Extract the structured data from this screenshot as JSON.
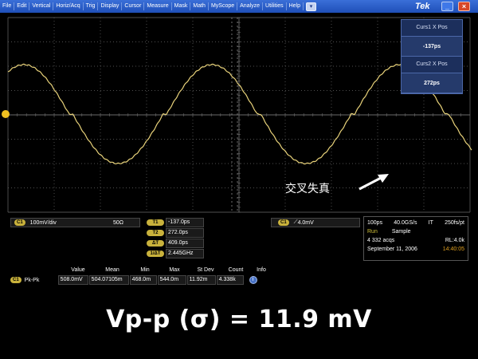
{
  "menubar": {
    "items": [
      "File",
      "Edit",
      "Vertical",
      "Horiz/Acq",
      "Trig",
      "Display",
      "Cursor",
      "Measure",
      "Mask",
      "Math",
      "MyScope",
      "Analyze",
      "Utilities",
      "Help"
    ],
    "brand": "Tek",
    "dropdown_symbol": "▾",
    "minimize_symbol": "_",
    "close_symbol": "×"
  },
  "cursor_box": {
    "curs1_label": "Curs1 X Pos",
    "curs1_value": "-137ps",
    "curs2_label": "Curs2 X Pos",
    "curs2_value": "272ps"
  },
  "annotation": {
    "text": "交叉失真",
    "arrow_icon": "arrow-icon"
  },
  "channel": {
    "badge": "C1",
    "scale": "100mV/div",
    "impedance": "50Ω"
  },
  "cursor_readouts": [
    {
      "badge": "T1",
      "value": "-137.0ps"
    },
    {
      "badge": "T2",
      "value": "272.0ps"
    },
    {
      "badge": "ΔT",
      "value": "409.0ps"
    },
    {
      "badge": "1/ΔT",
      "value": "2.445GHz"
    }
  ],
  "trigger": {
    "badge": "C1",
    "edge_symbol": "⟋",
    "level": "4.0mV"
  },
  "acquisition": {
    "timebase": "100ps",
    "sample_rate": "40.0GS/s",
    "mode": "IT",
    "resolution": "250fs/pt",
    "run_label": "Run",
    "sample_label": "Sample",
    "acqs": "4 332 acqs",
    "record_length": "RL:4.0k",
    "date": "September 11, 2006",
    "time": "14:40:05"
  },
  "measurement": {
    "headers": [
      "Value",
      "Mean",
      "Min",
      "Max",
      "St Dev",
      "Count",
      "Info"
    ],
    "badge": "C1",
    "name": "Pk-Pk",
    "values": [
      "508.0mV",
      "504.07105m",
      "468.0m",
      "544.0m",
      "11.92m",
      "4.338k"
    ],
    "info_icon": "i"
  },
  "formula": "Vp-p (σ) = 11.9 mV",
  "colors": {
    "trace": "#e8d27a",
    "grid": "#6a6a6a",
    "marker": "#f0c020",
    "menubar": "#2a5cc6"
  }
}
